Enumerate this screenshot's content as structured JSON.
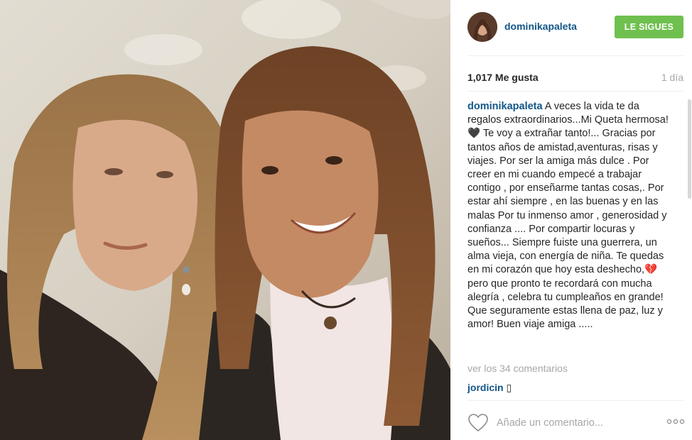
{
  "post": {
    "image_alt": "Selfie of two smiling women with long brown hair",
    "username": "dominikapaleta",
    "follow_button": "LE SIGUES",
    "likes": "1,017 Me gusta",
    "time": "1 día",
    "caption_user": "dominikapaleta",
    "caption_text": "A veces la vida te da regalos extraordinarios...Mi Queta hermosa! 🖤 Te voy a extrañar tanto!... Gracias por tantos años de amistad,aventuras, risas y viajes. Por ser la amiga más dulce . Por creer en mi cuando empecé a trabajar contigo , por enseñarme tantas cosas,. Por estar ahí siempre , en las buenas y en las malas Por tu inmenso amor , generosidad y confianza .... Por compartir locuras y sueños... Siempre fuiste una guerrera, un alma vieja, con energía de niña. Te quedas en mi corazón que hoy esta deshecho,💔 pero que pronto te recordará con mucha alegría , celebra tu cumpleaños en grande! Que seguramente estas llena de paz, luz y amor! Buen viaje amiga .....",
    "view_comments": "ver los 34 comentarios",
    "comments": [
      {
        "user": "jordicin",
        "text": "▯"
      }
    ],
    "comment_placeholder": "Añade un comentario...",
    "more_options": "..."
  },
  "colors": {
    "username_blue": "#125688",
    "follow_green": "#70c050",
    "muted_gray": "#a5a7aa",
    "text": "#262626"
  },
  "icons": {
    "like": "heart-outline-icon",
    "options": "ellipsis-icon"
  }
}
